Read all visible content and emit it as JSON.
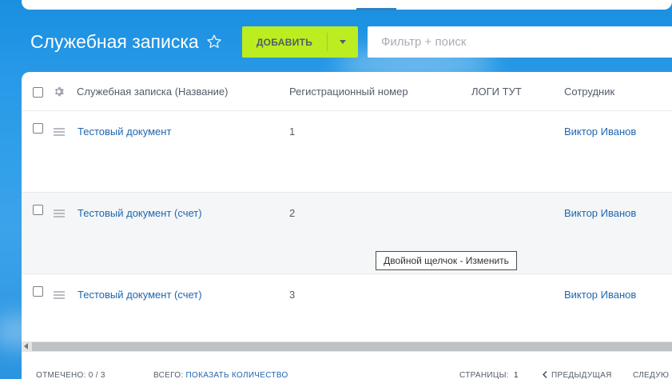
{
  "page": {
    "title": "Служебная записка"
  },
  "toolbar": {
    "add_label": "ДОБАВИТЬ",
    "search_placeholder": "Фильтр + поиск"
  },
  "grid": {
    "columns": [
      "Служебная записка (Название)",
      "Регистрационный номер",
      "ЛОГИ ТУТ",
      "Сотрудник"
    ],
    "rows": [
      {
        "name": "Тестовый документ",
        "number": "1",
        "logs": "",
        "employee": "Виктор Иванов"
      },
      {
        "name": "Тестовый документ (счет)",
        "number": "2",
        "logs": "",
        "employee": "Виктор Иванов"
      },
      {
        "name": "Тестовый документ (счет)",
        "number": "3",
        "logs": "",
        "employee": "Виктор Иванов"
      }
    ]
  },
  "tooltip": "Двойной щелчок - Изменить",
  "footer": {
    "selected_label": "ОТМЕЧЕНО:",
    "selected_value": "0 / 3",
    "total_label": "ВСЕГО:",
    "total_link": "ПОКАЗАТЬ КОЛИЧЕСТВО",
    "pages_label": "СТРАНИЦЫ:",
    "pages_value": "1",
    "prev_label": "ПРЕДЫДУЩАЯ",
    "next_label": "СЛЕДУЮ"
  },
  "colors": {
    "add_button": "#bbed21",
    "link": "#2067b0",
    "background": "#2a9be8"
  },
  "icons": [
    "star-icon",
    "gear-icon",
    "caret-down-icon",
    "menu-icon",
    "chevron-left-icon"
  ]
}
